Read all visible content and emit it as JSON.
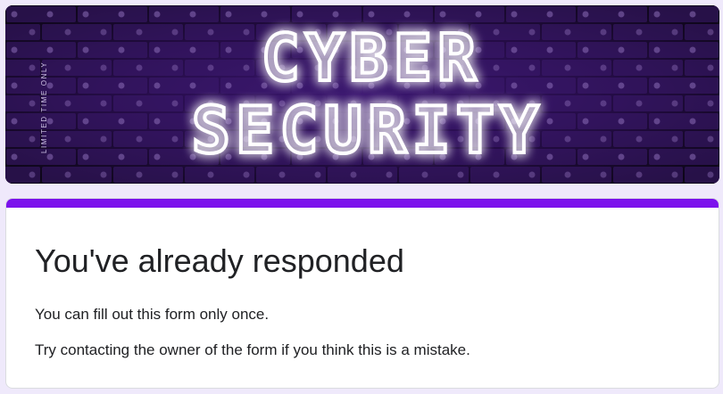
{
  "banner": {
    "headline_line1": "CYBER",
    "headline_line2": "SECURITY",
    "side_text": "LIMITED TIME ONLY",
    "colors": {
      "background": "#160a26",
      "brick_purple": "#4a1f8a",
      "glow_text": "#ffffff"
    }
  },
  "card": {
    "accent_color": "#7b12ec",
    "title": "You've already responded",
    "message_1": "You can fill out this form only once.",
    "message_2": "Try contacting the owner of the form if you think this is a mistake."
  }
}
